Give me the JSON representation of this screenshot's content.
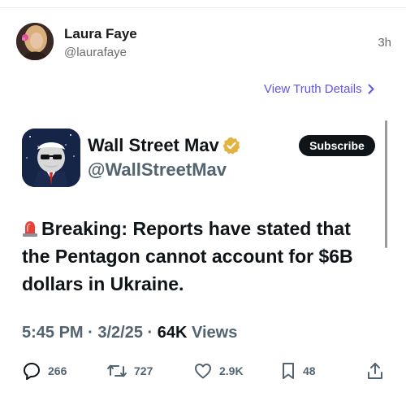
{
  "post": {
    "author_name": "Laura Faye",
    "author_handle": "@laurafaye",
    "time": "3h",
    "details_link": "View Truth Details",
    "details_icon": "chevron-right-icon"
  },
  "embed": {
    "name": "Wall Street Mav",
    "handle": "@WallStreetMav",
    "verified_icon": "verified-badge-icon",
    "subscribe_label": "Subscribe",
    "text_icon": "police-light-emoji",
    "text": "Breaking: Reports have stated that the Pentagon cannot account for $6B dollars in Ukraine.",
    "time": "5:45 PM",
    "sep1": " · ",
    "date": "3/2/25",
    "sep2": " · ",
    "views_count": "64K",
    "views_label": " Views",
    "actions": {
      "replies": "266",
      "reposts": "727",
      "likes": "2.9K",
      "bookmarks": "48"
    }
  },
  "colors": {
    "link": "#5f56e6",
    "subscribe_bg": "#0f1419",
    "muted": "#536471",
    "verified": "#e3b341"
  }
}
